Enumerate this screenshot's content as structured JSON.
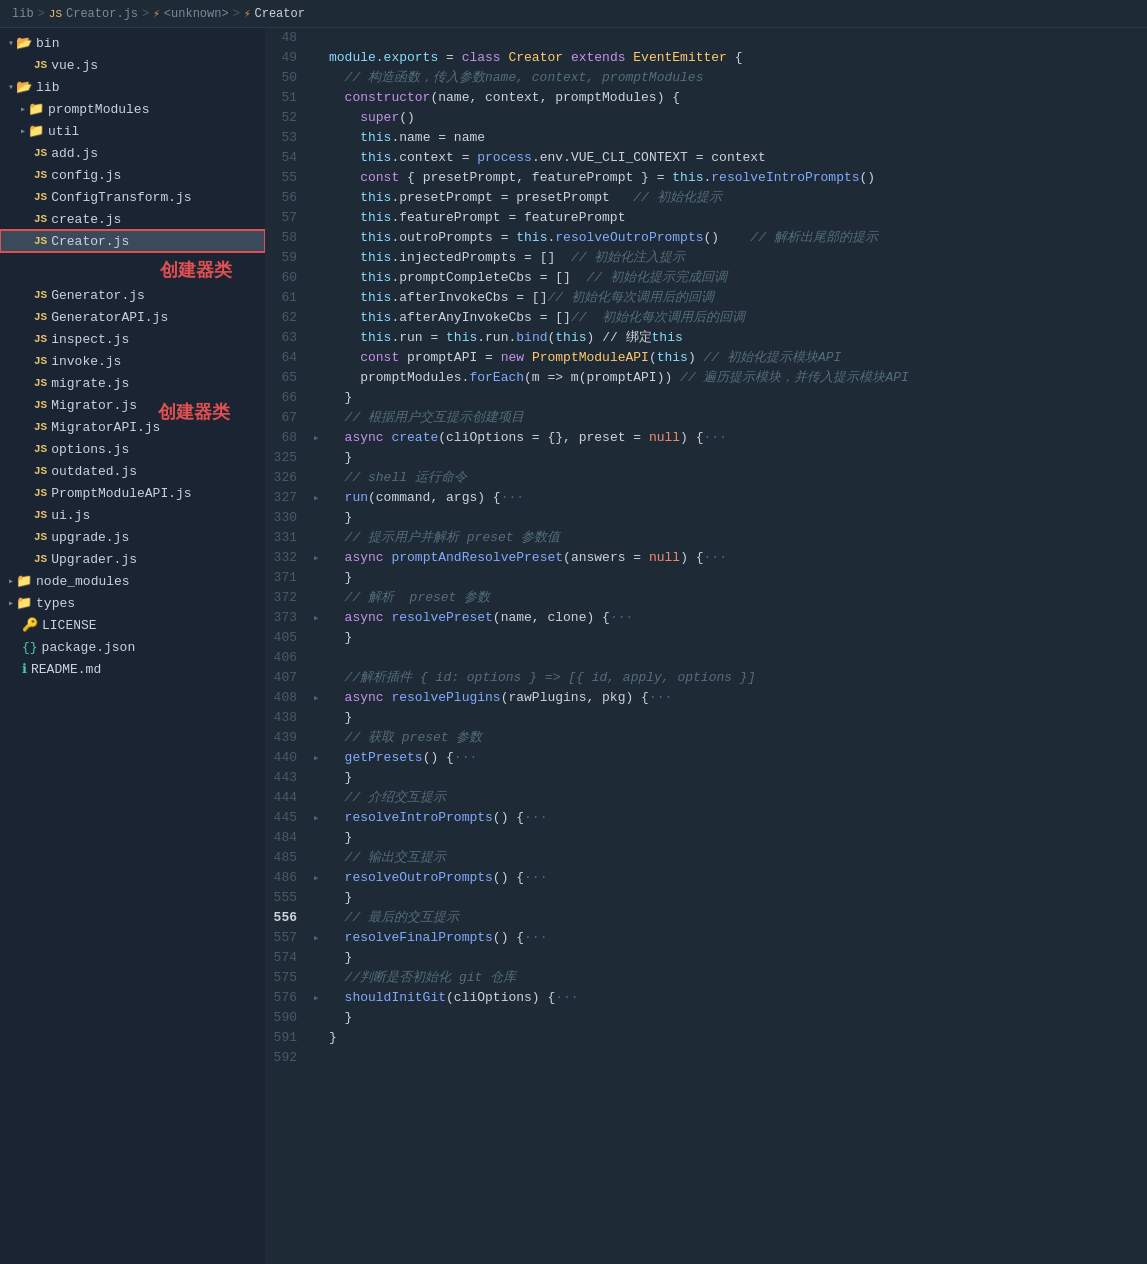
{
  "breadcrumb": {
    "parts": [
      {
        "text": "lib",
        "type": "folder"
      },
      {
        "text": ">",
        "type": "sep"
      },
      {
        "text": "JS",
        "type": "js-badge"
      },
      {
        "text": "Creator.js",
        "type": "link"
      },
      {
        "text": ">",
        "type": "sep"
      },
      {
        "text": "⚡",
        "type": "icon"
      },
      {
        "text": "<unknown>",
        "type": "link"
      },
      {
        "text": ">",
        "type": "sep"
      },
      {
        "text": "⚡",
        "type": "icon"
      },
      {
        "text": "Creator",
        "type": "active"
      }
    ]
  },
  "sidebar": {
    "items": [
      {
        "id": "bin",
        "label": "bin",
        "type": "folder-open",
        "indent": 0
      },
      {
        "id": "vuejs",
        "label": "vue.js",
        "type": "js",
        "indent": 1
      },
      {
        "id": "lib",
        "label": "lib",
        "type": "folder-open",
        "indent": 0
      },
      {
        "id": "promptModules",
        "label": "promptModules",
        "type": "folder-closed",
        "indent": 1
      },
      {
        "id": "util",
        "label": "util",
        "type": "folder-closed",
        "indent": 1
      },
      {
        "id": "addjs",
        "label": "add.js",
        "type": "js",
        "indent": 1
      },
      {
        "id": "configjs",
        "label": "config.js",
        "type": "js",
        "indent": 1
      },
      {
        "id": "ConfigTransformjs",
        "label": "ConfigTransform.js",
        "type": "js",
        "indent": 1
      },
      {
        "id": "createjs",
        "label": "create.js",
        "type": "js",
        "indent": 1
      },
      {
        "id": "Creatorjs",
        "label": "Creator.js",
        "type": "js",
        "indent": 1,
        "active": true
      },
      {
        "id": "Generatorjs",
        "label": "Generator.js",
        "type": "js",
        "indent": 1
      },
      {
        "id": "GeneratorAPIjs",
        "label": "GeneratorAPI.js",
        "type": "js",
        "indent": 1
      },
      {
        "id": "inspectjs",
        "label": "inspect.js",
        "type": "js",
        "indent": 1
      },
      {
        "id": "invokejs",
        "label": "invoke.js",
        "type": "js",
        "indent": 1
      },
      {
        "id": "migratejs",
        "label": "migrate.js",
        "type": "js",
        "indent": 1
      },
      {
        "id": "Migratorjs",
        "label": "Migrator.js",
        "type": "js",
        "indent": 1
      },
      {
        "id": "MigratorAPIjs",
        "label": "MigratorAPI.js",
        "type": "js",
        "indent": 1
      },
      {
        "id": "optionsjs",
        "label": "options.js",
        "type": "js",
        "indent": 1
      },
      {
        "id": "outdatedjs",
        "label": "outdated.js",
        "type": "js",
        "indent": 1
      },
      {
        "id": "PromptModuleAPIjs",
        "label": "PromptModuleAPI.js",
        "type": "js",
        "indent": 1
      },
      {
        "id": "uijs",
        "label": "ui.js",
        "type": "js",
        "indent": 1
      },
      {
        "id": "upgradejs",
        "label": "upgrade.js",
        "type": "js",
        "indent": 1
      },
      {
        "id": "Upgraderjs",
        "label": "Upgrader.js",
        "type": "js",
        "indent": 1
      },
      {
        "id": "node_modules",
        "label": "node_modules",
        "type": "folder-closed",
        "indent": 0
      },
      {
        "id": "types",
        "label": "types",
        "type": "folder-closed",
        "indent": 0
      },
      {
        "id": "LICENSE",
        "label": "LICENSE",
        "type": "license",
        "indent": 0
      },
      {
        "id": "packagejson",
        "label": "package.json",
        "type": "pkg",
        "indent": 0
      },
      {
        "id": "READMEmd",
        "label": "README.md",
        "type": "readme",
        "indent": 0
      }
    ],
    "annotation": "创建器类"
  },
  "code": {
    "lines": [
      {
        "num": "48",
        "bold": false,
        "fold": false,
        "content": ""
      },
      {
        "num": "49",
        "bold": false,
        "fold": false,
        "content": "module.exports = class Creator extends EventEmitter {"
      },
      {
        "num": "50",
        "bold": false,
        "fold": false,
        "content": "  // 构造函数，传入参数name, context, promptModules"
      },
      {
        "num": "51",
        "bold": false,
        "fold": false,
        "content": "  constructor(name, context, promptModules) {"
      },
      {
        "num": "52",
        "bold": false,
        "fold": false,
        "content": "    super()"
      },
      {
        "num": "53",
        "bold": false,
        "fold": false,
        "content": "    this.name = name"
      },
      {
        "num": "54",
        "bold": false,
        "fold": false,
        "content": "    this.context = process.env.VUE_CLI_CONTEXT = context"
      },
      {
        "num": "55",
        "bold": false,
        "fold": false,
        "content": "    const { presetPrompt, featurePrompt } = this.resolveIntroPrompts()"
      },
      {
        "num": "56",
        "bold": false,
        "fold": false,
        "content": "    this.presetPrompt = presetPrompt   // 初始化提示"
      },
      {
        "num": "57",
        "bold": false,
        "fold": false,
        "content": "    this.featurePrompt = featurePrompt"
      },
      {
        "num": "58",
        "bold": false,
        "fold": false,
        "content": "    this.outroPrompts = this.resolveOutroPrompts()    // 解析出尾部的提示"
      },
      {
        "num": "59",
        "bold": false,
        "fold": false,
        "content": "    this.injectedPrompts = []  // 初始化注入提示"
      },
      {
        "num": "60",
        "bold": false,
        "fold": false,
        "content": "    this.promptCompleteCbs = []  // 初始化提示完成回调"
      },
      {
        "num": "61",
        "bold": false,
        "fold": false,
        "content": "    this.afterInvokeCbs = []// 初始化每次调用后的回调"
      },
      {
        "num": "62",
        "bold": false,
        "fold": false,
        "content": "    this.afterAnyInvokeCbs = []//  初始化每次调用后的回调"
      },
      {
        "num": "63",
        "bold": false,
        "fold": false,
        "content": "    this.run = this.run.bind(this) // 绑定this"
      },
      {
        "num": "64",
        "bold": false,
        "fold": false,
        "content": "    const promptAPI = new PromptModuleAPI(this) // 初始化提示模块API"
      },
      {
        "num": "65",
        "bold": false,
        "fold": false,
        "content": "    promptModules.forEach(m => m(promptAPI)) // 遍历提示模块，并传入提示模块API"
      },
      {
        "num": "66",
        "bold": false,
        "fold": false,
        "content": "  }"
      },
      {
        "num": "67",
        "bold": false,
        "fold": false,
        "content": "  // 根据用户交互提示创建项目"
      },
      {
        "num": "68",
        "bold": false,
        "fold": true,
        "content": "  async create(cliOptions = {}, preset = null) {···"
      },
      {
        "num": "325",
        "bold": false,
        "fold": false,
        "content": "  }"
      },
      {
        "num": "326",
        "bold": false,
        "fold": false,
        "content": "  // shell 运行命令"
      },
      {
        "num": "327",
        "bold": false,
        "fold": true,
        "content": "  run(command, args) {···"
      },
      {
        "num": "330",
        "bold": false,
        "fold": false,
        "content": "  }"
      },
      {
        "num": "331",
        "bold": false,
        "fold": false,
        "content": "  // 提示用户并解析 preset 参数值"
      },
      {
        "num": "332",
        "bold": false,
        "fold": true,
        "content": "  async promptAndResolvePreset(answers = null) {···"
      },
      {
        "num": "371",
        "bold": false,
        "fold": false,
        "content": "  }"
      },
      {
        "num": "372",
        "bold": false,
        "fold": false,
        "content": "  // 解析  preset 参数"
      },
      {
        "num": "373",
        "bold": false,
        "fold": true,
        "content": "  async resolvePreset(name, clone) {···"
      },
      {
        "num": "405",
        "bold": false,
        "fold": false,
        "content": "  }"
      },
      {
        "num": "406",
        "bold": false,
        "fold": false,
        "content": ""
      },
      {
        "num": "407",
        "bold": false,
        "fold": false,
        "content": "  //解析插件 { id: options } => [{ id, apply, options }]"
      },
      {
        "num": "408",
        "bold": false,
        "fold": true,
        "content": "  async resolvePlugins(rawPlugins, pkg) {···"
      },
      {
        "num": "438",
        "bold": false,
        "fold": false,
        "content": "  }"
      },
      {
        "num": "439",
        "bold": false,
        "fold": false,
        "content": "  // 获取 preset 参数"
      },
      {
        "num": "440",
        "bold": false,
        "fold": true,
        "content": "  getPresets() {···"
      },
      {
        "num": "443",
        "bold": false,
        "fold": false,
        "content": "  }"
      },
      {
        "num": "444",
        "bold": false,
        "fold": false,
        "content": "  // 介绍交互提示"
      },
      {
        "num": "445",
        "bold": false,
        "fold": true,
        "content": "  resolveIntroPrompts() {···"
      },
      {
        "num": "484",
        "bold": false,
        "fold": false,
        "content": "  }"
      },
      {
        "num": "485",
        "bold": false,
        "fold": false,
        "content": "  // 输出交互提示"
      },
      {
        "num": "486",
        "bold": false,
        "fold": true,
        "content": "  resolveOutroPrompts() {···"
      },
      {
        "num": "555",
        "bold": false,
        "fold": false,
        "content": "  }"
      },
      {
        "num": "556",
        "bold": true,
        "fold": false,
        "content": "  // 最后的交互提示"
      },
      {
        "num": "557",
        "bold": false,
        "fold": true,
        "content": "  resolveFinalPrompts() {···"
      },
      {
        "num": "574",
        "bold": false,
        "fold": false,
        "content": "  }"
      },
      {
        "num": "575",
        "bold": false,
        "fold": false,
        "content": "  //判断是否初始化 git 仓库"
      },
      {
        "num": "576",
        "bold": false,
        "fold": true,
        "content": "  shouldInitGit(cliOptions) {···"
      },
      {
        "num": "590",
        "bold": false,
        "fold": false,
        "content": "  }"
      },
      {
        "num": "591",
        "bold": false,
        "fold": false,
        "content": "}"
      },
      {
        "num": "592",
        "bold": false,
        "fold": false,
        "content": ""
      }
    ]
  }
}
